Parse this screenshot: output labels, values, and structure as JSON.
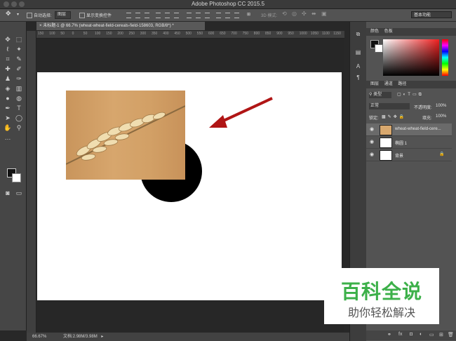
{
  "window": {
    "title": "Adobe Photoshop CC 2015.5"
  },
  "options_bar": {
    "auto_select_label": "自动选择:",
    "auto_select_value": "图层",
    "transform_controls_label": "显示变换控件",
    "mode_3d_label": "3D 模式:",
    "workspace": "基本功能"
  },
  "document": {
    "tab_title": "未标题-1 @ 66.7% (wheat-wheat-field-cereals-field-158603, RGB/8*) *",
    "ruler_ticks": [
      "150",
      "100",
      "50",
      "0",
      "50",
      "100",
      "150",
      "200",
      "250",
      "300",
      "350",
      "400",
      "450",
      "500",
      "550",
      "600",
      "650",
      "700",
      "750",
      "800",
      "850",
      "900",
      "950",
      "1000",
      "1050",
      "1100",
      "1150"
    ]
  },
  "status_bar": {
    "zoom": "66.67%",
    "doc_info": "文档:2.98M/3.98M"
  },
  "tools": [
    "move-icon",
    "marquee-icon",
    "lasso-icon",
    "magic-wand-icon",
    "crop-icon",
    "eyedropper-icon",
    "healing-icon",
    "brush-icon",
    "stamp-icon",
    "history-brush-icon",
    "eraser-icon",
    "gradient-icon",
    "blur-icon",
    "dodge-icon",
    "pen-icon",
    "type-icon",
    "path-select-icon",
    "shape-icon",
    "hand-icon",
    "zoom-icon"
  ],
  "color_panel": {
    "tabs": [
      "颜色",
      "色板"
    ],
    "foreground": "#111111",
    "background": "#ffffff"
  },
  "layers_panel": {
    "tabs": [
      "图层",
      "通道",
      "路径"
    ],
    "filter_label": "类型",
    "blend_mode": "正常",
    "opacity_label": "不透明度:",
    "opacity_value": "100%",
    "lock_label": "锁定:",
    "fill_label": "填充:",
    "fill_value": "100%",
    "layers": [
      {
        "name": "wheat-wheat-field-cere...",
        "selected": true
      },
      {
        "name": "椭圆 1",
        "selected": false
      },
      {
        "name": "背景",
        "selected": false
      }
    ]
  },
  "watermark": {
    "main": "百科全说",
    "sub": "助你轻松解决"
  },
  "colors": {
    "accent_arrow": "#b01515",
    "watermark_green": "#3cb049"
  }
}
